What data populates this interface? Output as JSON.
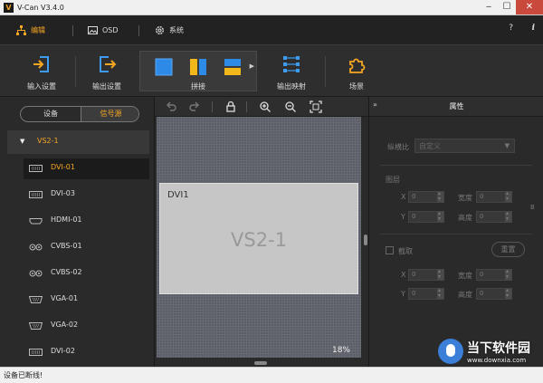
{
  "window": {
    "title": "V-Can V3.4.0",
    "logo": "V"
  },
  "menubar": {
    "tabs": [
      {
        "label": "编辑",
        "icon": "edit-hierarchy-icon",
        "active": true
      },
      {
        "label": "OSD",
        "icon": "image-icon",
        "active": false
      },
      {
        "label": "系统",
        "icon": "gear-icon",
        "active": false
      }
    ],
    "help": "?",
    "info": "i"
  },
  "toolbar": {
    "input_settings": "输入设置",
    "output_settings": "输出设置",
    "splice": "拼接",
    "output_mapping": "输出映射",
    "scene": "场景"
  },
  "left_panel": {
    "tabs": [
      "设备",
      "信号源"
    ],
    "active_tab": "信号源",
    "group": "VS2-1",
    "sources": [
      {
        "name": "DVI-01",
        "icon": "dvi-port-icon",
        "active": true
      },
      {
        "name": "DVI-03",
        "icon": "dvi-port-icon",
        "active": false
      },
      {
        "name": "HDMI-01",
        "icon": "hdmi-port-icon",
        "active": false
      },
      {
        "name": "CVBS-01",
        "icon": "cvbs-port-icon",
        "active": false
      },
      {
        "name": "CVBS-02",
        "icon": "cvbs-port-icon",
        "active": false
      },
      {
        "name": "VGA-01",
        "icon": "vga-port-icon",
        "active": false
      },
      {
        "name": "VGA-02",
        "icon": "vga-port-icon",
        "active": false
      },
      {
        "name": "DVI-02",
        "icon": "dvi-port-icon",
        "active": false
      }
    ]
  },
  "canvas": {
    "output_name": "DVI1",
    "group_name": "VS2-1",
    "zoom": "18%"
  },
  "properties": {
    "title": "属性",
    "collapse": "»",
    "aspect_label": "纵横比",
    "aspect_value": "自定义",
    "layer_label": "图层",
    "x_label": "X",
    "y_label": "Y",
    "width_label": "宽度",
    "height_label": "高度",
    "zero": "0",
    "b_mark": "B",
    "crop_label": "截取",
    "reset_button": "重置"
  },
  "status": {
    "text": "设备已断线!"
  },
  "watermark": {
    "text": "当下软件园",
    "url": "www.downxia.com"
  },
  "colors": {
    "accent": "#f5a623",
    "close": "#c94a3c",
    "splice_blue": "#2d8ae6",
    "splice_yellow": "#f2b81b"
  }
}
